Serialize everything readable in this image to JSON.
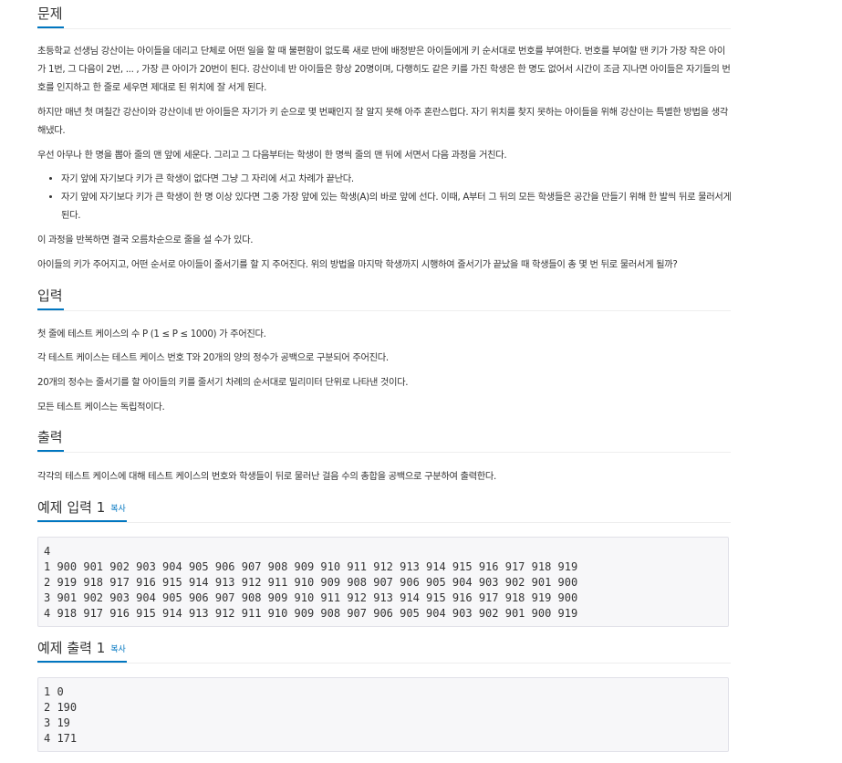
{
  "sections": {
    "problem": {
      "title": "문제",
      "paragraphs": [
        "초등학교 선생님 강산이는 아이들을 데리고 단체로 어떤 일을 할 때 불편함이 없도록 새로 반에 배정받은 아이들에게 키 순서대로 번호를 부여한다. 번호를 부여할 땐 키가 가장 작은 아이가 1번, 그 다음이 2번, ... , 가장 큰 아이가 20번이 된다. 강산이네 반 아이들은 항상 20명이며, 다행히도 같은 키를 가진 학생은 한 명도 없어서 시간이 조금 지나면 아이들은 자기들의 번호를 인지하고 한 줄로 세우면 제대로 된 위치에 잘 서게 된다.",
        "하지만 매년 첫 며칠간 강산이와 강산이네 반 아이들은 자기가 키 순으로 몇 번째인지 잘 알지 못해 아주 혼란스럽다. 자기 위치를 찾지 못하는 아이들을 위해 강산이는 특별한 방법을 생각해냈다.",
        "우선 아무나 한 명을 뽑아 줄의 맨 앞에 세운다. 그리고 그 다음부터는 학생이 한 명씩 줄의 맨 뒤에 서면서 다음 과정을 거친다."
      ],
      "bullets": [
        "자기 앞에 자기보다 키가 큰 학생이 없다면 그냥 그 자리에 서고 차례가 끝난다.",
        "자기 앞에 자기보다 키가 큰 학생이 한 명 이상 있다면 그중 가장 앞에 있는 학생(A)의 바로 앞에 선다. 이때, A부터 그 뒤의 모든 학생들은 공간을 만들기 위해 한 발씩 뒤로 물러서게 된다."
      ],
      "after": [
        "이 과정을 반복하면 결국 오름차순으로 줄을 설 수가 있다.",
        "아이들의 키가 주어지고, 어떤 순서로 아이들이 줄서기를 할 지 주어진다. 위의 방법을 마지막 학생까지 시행하여 줄서기가 끝났을 때 학생들이 총 몇 번 뒤로 물러서게 될까?"
      ]
    },
    "input": {
      "title": "입력",
      "paragraphs": [
        "첫 줄에 테스트 케이스의 수 P (1 ≤ P ≤ 1000) 가 주어진다.",
        "각 테스트 케이스는 테스트 케이스 번호 T와 20개의 양의 정수가 공백으로 구분되어 주어진다.",
        "20개의 정수는 줄서기를 할 아이들의 키를 줄서기 차례의 순서대로 밀리미터 단위로 나타낸 것이다.",
        "모든 테스트 케이스는 독립적이다."
      ]
    },
    "output": {
      "title": "출력",
      "paragraphs": [
        "각각의 테스트 케이스에 대해 테스트 케이스의 번호와 학생들이 뒤로 물러난 걸음 수의 총합을 공백으로 구분하여 출력한다."
      ]
    },
    "sample_input": {
      "title": "예제 입력 1",
      "copy_label": "복사",
      "text": "4\n1 900 901 902 903 904 905 906 907 908 909 910 911 912 913 914 915 916 917 918 919\n2 919 918 917 916 915 914 913 912 911 910 909 908 907 906 905 904 903 902 901 900\n3 901 902 903 904 905 906 907 908 909 910 911 912 913 914 915 916 917 918 919 900\n4 918 917 916 915 914 913 912 911 910 909 908 907 906 905 904 903 902 901 900 919"
    },
    "sample_output": {
      "title": "예제 출력 1",
      "copy_label": "복사",
      "text": "1 0\n2 190\n3 19\n4 171"
    }
  },
  "colors": {
    "accent": "#0076c0",
    "text": "#333333",
    "code_bg": "#f7f7f9"
  }
}
